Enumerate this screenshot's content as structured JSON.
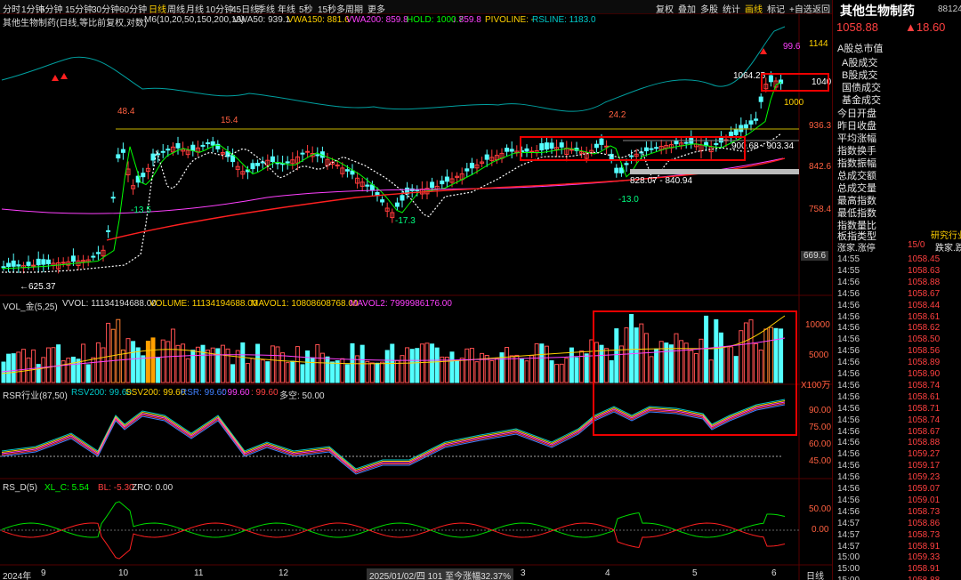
{
  "toolbar_left": [
    "分时",
    "1分钟",
    "5分钟",
    "15分钟",
    "30分钟",
    "60分钟",
    "日线",
    "周线",
    "月线",
    "10分钟",
    "45日线",
    "季线",
    "年线",
    "5秒",
    "15秒",
    "多周期",
    "更多"
  ],
  "active_period": "日线",
  "toolbar_right": [
    "复权",
    "叠加",
    "多股",
    "统计",
    "画线",
    "标记",
    "+自选",
    "返回"
  ],
  "ma_line": {
    "name": "其他生物制药(日线,等比前复权,对数)",
    "ma": "M6(10,20,50,150,200,13)",
    "vwa50": "VWA50: 939.1",
    "vwa150": "VWA150: 881.6",
    "vwa200": "VWA200: 859.8",
    "hold_a": "HOLD: 1000.7",
    "hold_b": "↓ 859.8",
    "pivot": "PIVOLINE: -",
    "rsline": "RSLINE: 1183.0"
  },
  "price_axis": [
    "1144",
    "1040",
    "936.3",
    "842.6",
    "758.4",
    "669.6"
  ],
  "price_annotations": {
    "hi1": "48.4",
    "hi2": "15.4",
    "hi3": "24.2",
    "lo1": "-13.5",
    "lo2": "-17.3",
    "lo3": "-13.0",
    "low": "←625.37",
    "r1": "1064.25",
    "r2": "1000",
    "r3": "99.6",
    "rng1": "900.68 - 903.34",
    "rng2": "828.07 - 840.94"
  },
  "vol_header": {
    "name": "VOL_金(5,25)",
    "vvol": "VVOL: 11134194688.00",
    "volume": "VOLUME: 11134194688.00",
    "mavol1": "MAVOL1: 10808608768.00",
    "mavol2": "MAVOL2: 7999986176.00"
  },
  "vol_axis": [
    "10000",
    "5000",
    "X100万"
  ],
  "rsr_header": {
    "name": "RSR行业(87,50)",
    "rsv": "RSV200: 99.60",
    "ssv": "SSV200: 99.60",
    "rsr": "RSR: 99.60",
    "a": ": 99.60",
    "b": ": 99.60",
    "c": "多空: 50.00"
  },
  "rsr_axis": [
    "90.00",
    "75.00",
    "60.00",
    "45.00"
  ],
  "rsd_header": {
    "name": "RS_D(5)",
    "xl": "XL_C: 5.54",
    "bl": "BL: -5.30",
    "zro": "ZRO: 0.00"
  },
  "rsd_axis": [
    "50.00",
    "0.00"
  ],
  "date_axis": [
    "2024年",
    "9",
    "10",
    "11",
    "12",
    "2025/01/02/四 101 至今涨幅32.37%",
    "3",
    "4",
    "5",
    "6",
    "日线"
  ],
  "panel": {
    "title": "其他生物制药",
    "code": "881240",
    "price": "1058.88",
    "change": "▲18.60",
    "labels": [
      "A股总市值",
      "A股成交",
      "B股成交",
      "国债成交",
      "基金成交",
      "今日开盘",
      "昨日收盘",
      "平均涨幅",
      "指数换手",
      "指数振幅",
      "总成交额",
      "总成交量",
      "最高指数",
      "最低指数",
      "指数量比",
      "板指类型"
    ],
    "type_value": "研究行业",
    "rise_limit": "涨家.涨停",
    "rise_count": "15/0",
    "fall_label": "跌家.跌"
  },
  "ticks": [
    [
      "14:55",
      "1058.45"
    ],
    [
      "14:55",
      "1058.63"
    ],
    [
      "14:56",
      "1058.88"
    ],
    [
      "14:56",
      "1058.67"
    ],
    [
      "14:56",
      "1058.44"
    ],
    [
      "14:56",
      "1058.61"
    ],
    [
      "14:56",
      "1058.62"
    ],
    [
      "14:56",
      "1058.50"
    ],
    [
      "14:56",
      "1058.56"
    ],
    [
      "14:56",
      "1058.89"
    ],
    [
      "14:56",
      "1058.90"
    ],
    [
      "14:56",
      "1058.74"
    ],
    [
      "14:56",
      "1058.61"
    ],
    [
      "14:56",
      "1058.71"
    ],
    [
      "14:56",
      "1058.74"
    ],
    [
      "14:56",
      "1058.67"
    ],
    [
      "14:56",
      "1058.88"
    ],
    [
      "14:56",
      "1059.27"
    ],
    [
      "14:56",
      "1059.17"
    ],
    [
      "14:56",
      "1059.23"
    ],
    [
      "14:56",
      "1059.07"
    ],
    [
      "14:56",
      "1059.01"
    ],
    [
      "14:56",
      "1058.73"
    ],
    [
      "14:57",
      "1058.86"
    ],
    [
      "14:57",
      "1058.73"
    ],
    [
      "14:57",
      "1058.91"
    ],
    [
      "15:00",
      "1059.33"
    ],
    [
      "15:00",
      "1058.91"
    ],
    [
      "15:00",
      "1058.88"
    ]
  ],
  "colors": {
    "up": "#ff3c3c",
    "down": "#54ffff",
    "accent": "#ffd000"
  }
}
